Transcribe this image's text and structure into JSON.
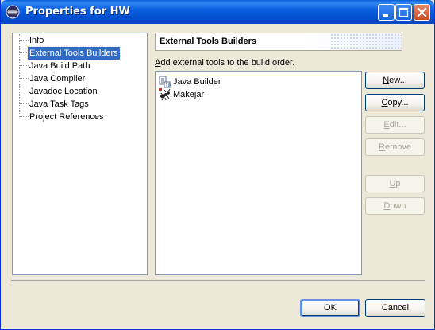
{
  "window": {
    "title": "Properties for HW"
  },
  "tree": {
    "items": [
      {
        "label": "Info",
        "selected": false
      },
      {
        "label": "External Tools Builders",
        "selected": true
      },
      {
        "label": "Java Build Path",
        "selected": false
      },
      {
        "label": "Java Compiler",
        "selected": false
      },
      {
        "label": "Javadoc Location",
        "selected": false
      },
      {
        "label": "Java Task Tags",
        "selected": false
      },
      {
        "label": "Project References",
        "selected": false
      }
    ]
  },
  "page": {
    "title": "External Tools Builders",
    "description_mnemonic": "A",
    "description_rest": "dd external tools to the build order."
  },
  "builders": [
    {
      "label": "Java Builder",
      "icon": "java-builder-icon"
    },
    {
      "label": "Makejar",
      "icon": "ant-icon"
    }
  ],
  "buttons": {
    "new": {
      "mnemonic": "N",
      "rest": "ew...",
      "enabled": true
    },
    "copy": {
      "mnemonic": "C",
      "rest": "opy...",
      "enabled": true
    },
    "edit": {
      "mnemonic": "E",
      "rest": "dit...",
      "enabled": false
    },
    "remove": {
      "mnemonic": "R",
      "rest": "emove",
      "enabled": false
    },
    "up": {
      "mnemonic": "U",
      "rest": "p",
      "enabled": false
    },
    "down": {
      "mnemonic": "D",
      "rest": "own",
      "enabled": false
    },
    "ok": "OK",
    "cancel": "Cancel"
  },
  "colors": {
    "titlebar": "#0a5fd8",
    "selection": "#316ac5",
    "dialog_bg": "#ece9d8"
  }
}
